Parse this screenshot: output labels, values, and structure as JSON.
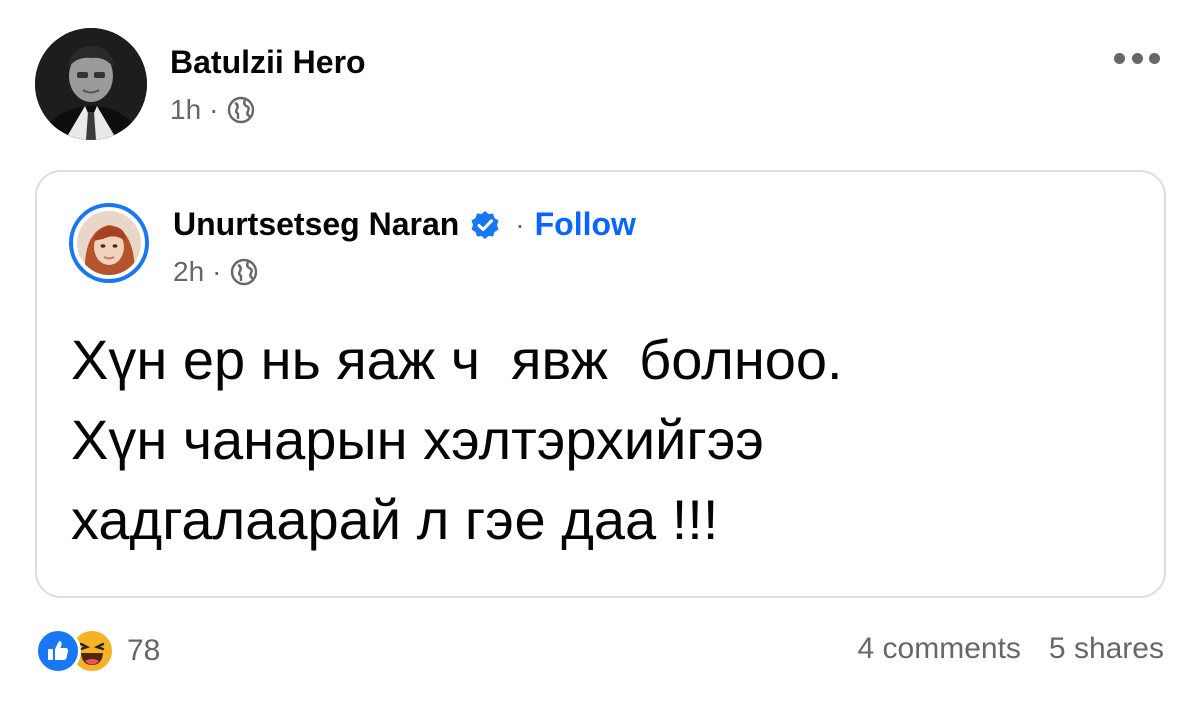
{
  "post": {
    "author": "Batulzii Hero",
    "time": "1h",
    "separator": "·",
    "audience_icon": "globe-icon",
    "more_icon": "more-dots-icon"
  },
  "shared": {
    "author": "Unurtsetseg Naran",
    "verified_icon": "verified-badge-icon",
    "separator": "·",
    "follow_label": "Follow",
    "time": "2h",
    "audience_icon": "globe-icon",
    "text_lines": [
      "Хүн ер нь яаж ч  явж  болноо.",
      "Хүн чанарын хэлтэрхийгээ",
      "хадгалаарай л гэе даа !!!"
    ]
  },
  "footer": {
    "reaction_icons": [
      "like-icon",
      "haha-icon"
    ],
    "reaction_count": "78",
    "comments": "4 comments",
    "shares": "5 shares"
  },
  "colors": {
    "accent": "#0866ff",
    "secondary_text": "#65676b",
    "like": "#1877f2",
    "haha": "#f7b125"
  }
}
